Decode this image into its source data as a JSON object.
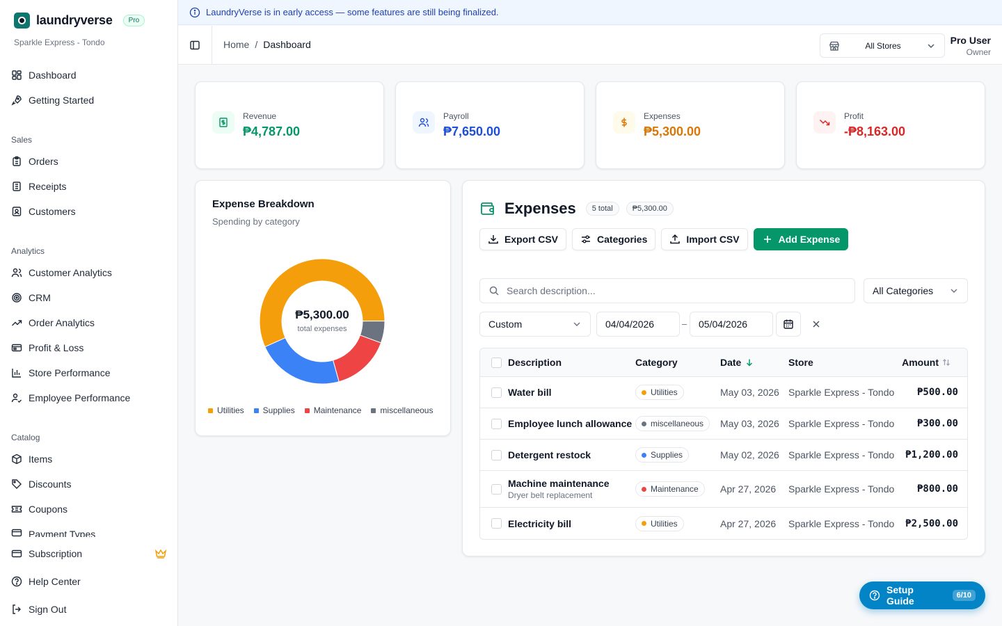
{
  "banner": {
    "text": "LaundryVerse is in early access — some features are still being finalized."
  },
  "brand": {
    "name": "laundryverse",
    "badge": "Pro",
    "store": "Sparkle Express - Tondo"
  },
  "sidebar": {
    "top": [
      {
        "label": "Dashboard",
        "icon": "dashboard-icon"
      },
      {
        "label": "Getting Started",
        "icon": "rocket-icon"
      }
    ],
    "sections": [
      {
        "title": "Sales",
        "items": [
          {
            "label": "Orders",
            "icon": "clipboard-icon"
          },
          {
            "label": "Receipts",
            "icon": "receipt-icon"
          },
          {
            "label": "Customers",
            "icon": "contact-icon"
          }
        ]
      },
      {
        "title": "Analytics",
        "items": [
          {
            "label": "Customer Analytics",
            "icon": "users-icon"
          },
          {
            "label": "CRM",
            "icon": "target-icon"
          },
          {
            "label": "Order Analytics",
            "icon": "trend-icon"
          },
          {
            "label": "Profit & Loss",
            "icon": "wallet-icon"
          },
          {
            "label": "Store Performance",
            "icon": "bar-chart-icon"
          },
          {
            "label": "Employee Performance",
            "icon": "user-check-icon"
          }
        ]
      },
      {
        "title": "Catalog",
        "items": [
          {
            "label": "Items",
            "icon": "package-icon"
          },
          {
            "label": "Discounts",
            "icon": "tag-icon"
          },
          {
            "label": "Coupons",
            "icon": "ticket-icon"
          },
          {
            "label": "Payment Types",
            "icon": "card-icon"
          }
        ]
      }
    ],
    "bottom": [
      {
        "label": "Subscription",
        "icon": "card-icon"
      },
      {
        "label": "Help Center",
        "icon": "help-icon"
      },
      {
        "label": "Sign Out",
        "icon": "logout-icon"
      }
    ]
  },
  "header": {
    "breadcrumb": [
      "Home",
      "Dashboard"
    ],
    "store_select": "All Stores",
    "user_name": "Pro User",
    "user_role": "Owner"
  },
  "kpis": [
    {
      "label": "Revenue",
      "value": "₱4,787.00",
      "color": "#059669",
      "bg": "#ecfdf5",
      "icon": "cash-icon"
    },
    {
      "label": "Payroll",
      "value": "₱7,650.00",
      "color": "#1d4ed8",
      "bg": "#eff6ff",
      "icon": "users-icon"
    },
    {
      "label": "Expenses",
      "value": "₱5,300.00",
      "color": "#d97706",
      "bg": "#fffbeb",
      "icon": "dollar-icon"
    },
    {
      "label": "Profit",
      "value": "-₱8,163.00",
      "color": "#dc2626",
      "bg": "#fef2f2",
      "icon": "trending-down-icon"
    }
  ],
  "breakdown": {
    "title": "Expense Breakdown",
    "subtitle": "Spending by category",
    "total": "₱5,300.00",
    "total_caption": "total expenses"
  },
  "chart_data": {
    "type": "pie",
    "categories": [
      "Utilities",
      "Supplies",
      "Maintenance",
      "miscellaneous"
    ],
    "values": [
      3000,
      1200,
      800,
      300
    ],
    "colors": [
      "#f59e0b",
      "#3b82f6",
      "#ef4444",
      "#6b7280"
    ],
    "legend": "bottom"
  },
  "expenses": {
    "title": "Expenses",
    "count_pill": "5 total",
    "total_pill": "₱5,300.00",
    "buttons": {
      "export": "Export CSV",
      "categories": "Categories",
      "import": "Import CSV",
      "add": "Add Expense"
    },
    "search_placeholder": "Search description...",
    "category_filter": "All Categories",
    "range": "Custom",
    "date_from": "04/04/2026",
    "date_to": "05/04/2026",
    "date_separator": "–",
    "columns": {
      "description": "Description",
      "category": "Category",
      "date": "Date",
      "store": "Store",
      "amount": "Amount"
    },
    "rows": [
      {
        "description": "Water bill",
        "note": "",
        "category": "Utilities",
        "cat_color": "#f59e0b",
        "date": "May 03, 2026",
        "store": "Sparkle Express - Tondo",
        "amount": "₱500.00"
      },
      {
        "description": "Employee lunch allowance",
        "note": "",
        "category": "miscellaneous",
        "cat_color": "#6b7280",
        "date": "May 03, 2026",
        "store": "Sparkle Express - Tondo",
        "amount": "₱300.00"
      },
      {
        "description": "Detergent restock",
        "note": "",
        "category": "Supplies",
        "cat_color": "#3b82f6",
        "date": "May 02, 2026",
        "store": "Sparkle Express - Tondo",
        "amount": "₱1,200.00"
      },
      {
        "description": "Machine maintenance",
        "note": "Dryer belt replacement",
        "category": "Maintenance",
        "cat_color": "#ef4444",
        "date": "Apr 27, 2026",
        "store": "Sparkle Express - Tondo",
        "amount": "₱800.00"
      },
      {
        "description": "Electricity bill",
        "note": "",
        "category": "Utilities",
        "cat_color": "#f59e0b",
        "date": "Apr 27, 2026",
        "store": "Sparkle Express - Tondo",
        "amount": "₱2,500.00"
      }
    ]
  },
  "setup_guide": {
    "label": "Setup Guide",
    "progress": "6/10"
  }
}
